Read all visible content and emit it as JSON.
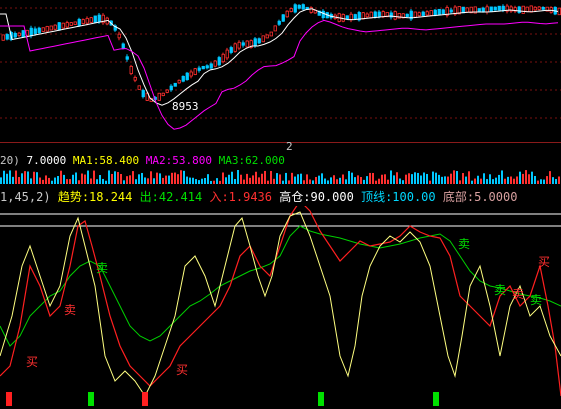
{
  "price_panel": {
    "low_label": "8953",
    "colors": {
      "up": "#ff3030",
      "down": "#00c8ff",
      "ma_slow": "#ffffff",
      "ma_mid": "#ff00ff",
      "grid": "#7a1010"
    }
  },
  "separator": {
    "label": "2"
  },
  "volume_header": {
    "params": "20)",
    "value": "7.0000",
    "ma1": "MA1:58.400",
    "ma2": "MA2:53.800",
    "ma3": "MA3:62.000"
  },
  "indicator_header": {
    "params": "1,45,2)",
    "trend": "趋势:18.244",
    "out": "出:42.414",
    "in": "入:1.9436",
    "high_pos": "高仓:90.000",
    "top_line": "顶线:100.00",
    "bottom": "底部:5.0000"
  },
  "indicator_labels": {
    "buy": "买",
    "sell": "卖"
  },
  "indicator_colors": {
    "trend": "#ffff80",
    "out": "#00d000",
    "in": "#ff2020",
    "top": "#ffffff"
  }
}
